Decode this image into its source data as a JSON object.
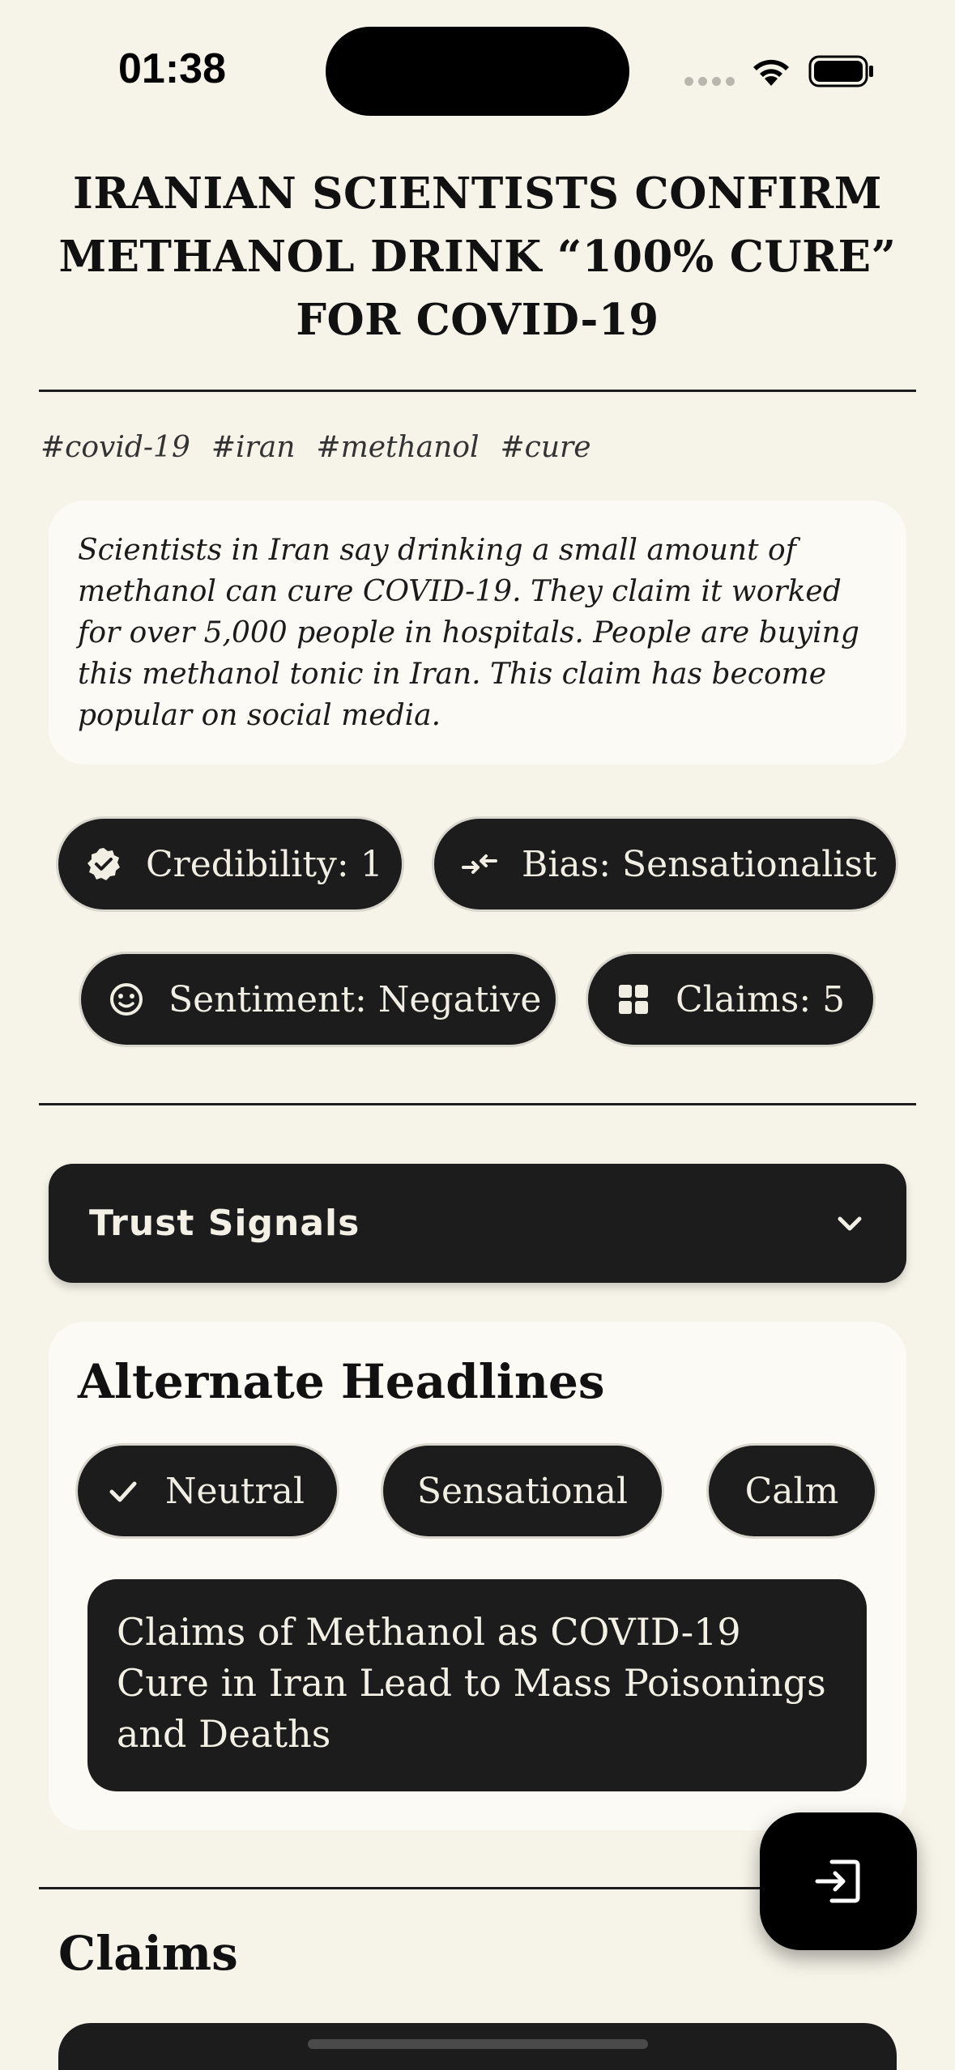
{
  "status_bar": {
    "time": "01:38"
  },
  "headline": "IRANIAN SCIENTISTS CONFIRM METHANOL DRINK “100% CURE” FOR COVID-19",
  "tags": [
    "#covid-19",
    "#iran",
    "#methanol",
    "#cure"
  ],
  "summary": "Scientists in Iran say drinking a small amount of methanol can cure COVID-19. They claim it worked for over 5,000 people in hospitals. People are buying this methanol tonic in Iran. This claim has become popular on social media.",
  "metrics": {
    "credibility": "Credibility: 1",
    "bias": "Bias: Sensationalist",
    "sentiment": "Sentiment: Negative",
    "claims": "Claims: 5"
  },
  "trust_signals": {
    "label": "Trust Signals"
  },
  "alternate_headlines": {
    "title": "Alternate Headlines",
    "tones": [
      "Neutral",
      "Sensational",
      "Calm"
    ],
    "selected_tone": "Neutral",
    "selected_text": "Claims of Methanol as COVID-19 Cure in Iran Lead to Mass Poisonings and Deaths"
  },
  "claims_section": {
    "title": "Claims"
  },
  "icons": {
    "credibility": "verified-badge-icon",
    "bias": "compare-arrows-icon",
    "sentiment": "smiley-icon",
    "claims": "grid-icon",
    "trust_toggle": "chevron-down-icon",
    "selected": "checkmark-icon",
    "fab": "exit-icon"
  }
}
